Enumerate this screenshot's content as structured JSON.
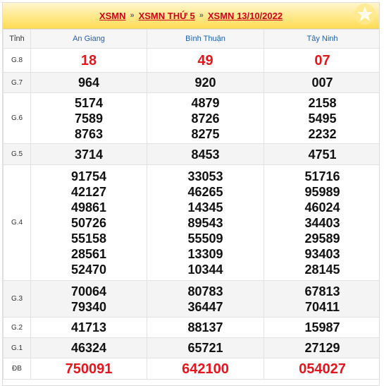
{
  "breadcrumb": {
    "items": [
      "XSMN",
      "XSMN THỨ 5",
      "XSMN 13/10/2022"
    ],
    "separator": "»"
  },
  "table": {
    "label_header": "Tỉnh",
    "provinces": [
      "An Giang",
      "Bình Thuận",
      "Tây Ninh"
    ],
    "rows": [
      {
        "label": "G.8",
        "values": [
          [
            "18"
          ],
          [
            "49"
          ],
          [
            "07"
          ]
        ]
      },
      {
        "label": "G.7",
        "values": [
          [
            "964"
          ],
          [
            "920"
          ],
          [
            "007"
          ]
        ]
      },
      {
        "label": "G.6",
        "values": [
          [
            "5174",
            "7589",
            "8763"
          ],
          [
            "4879",
            "8726",
            "8275"
          ],
          [
            "2158",
            "5495",
            "2232"
          ]
        ]
      },
      {
        "label": "G.5",
        "values": [
          [
            "3714"
          ],
          [
            "8453"
          ],
          [
            "4751"
          ]
        ]
      },
      {
        "label": "G.4",
        "values": [
          [
            "91754",
            "42127",
            "49861",
            "50726",
            "55158",
            "28561",
            "52470"
          ],
          [
            "33053",
            "46265",
            "14345",
            "89543",
            "55509",
            "13309",
            "10344"
          ],
          [
            "51716",
            "95989",
            "46024",
            "34403",
            "29589",
            "93403",
            "28145"
          ]
        ]
      },
      {
        "label": "G.3",
        "values": [
          [
            "70064",
            "79340"
          ],
          [
            "80783",
            "36447"
          ],
          [
            "67813",
            "70411"
          ]
        ]
      },
      {
        "label": "G.2",
        "values": [
          [
            "41713"
          ],
          [
            "88137"
          ],
          [
            "15987"
          ]
        ]
      },
      {
        "label": "G.1",
        "values": [
          [
            "46324"
          ],
          [
            "65721"
          ],
          [
            "27129"
          ]
        ]
      },
      {
        "label": "ĐB",
        "values": [
          [
            "750091"
          ],
          [
            "642100"
          ],
          [
            "054027"
          ]
        ]
      }
    ]
  },
  "colors": {
    "accent_red": "#e8141b",
    "province_blue": "#1f5fb4",
    "header_yellow": "#ffdc55"
  },
  "icons": {
    "header_decoration": "star-icon"
  }
}
